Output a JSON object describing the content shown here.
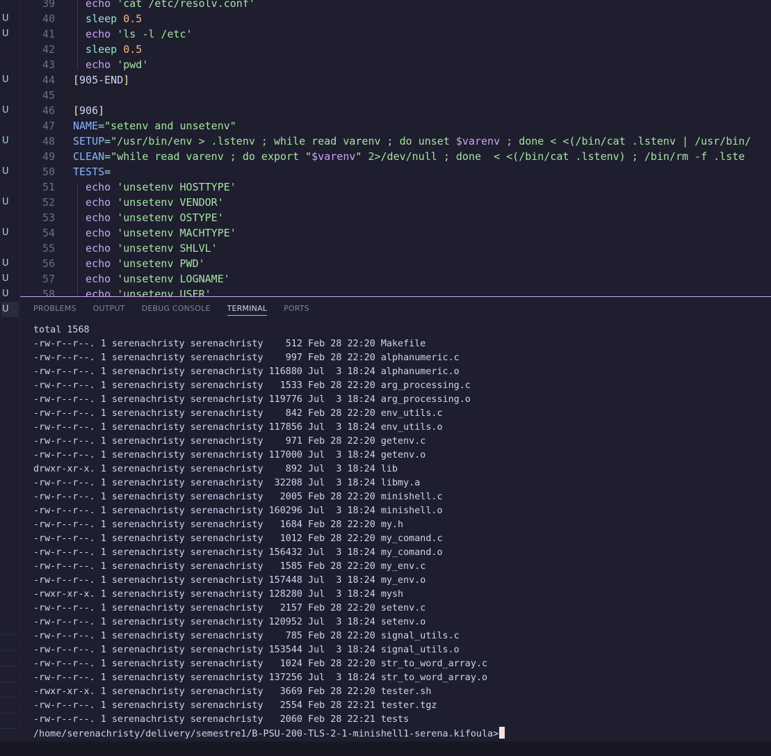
{
  "gutter": {
    "marks": [
      {
        "line": 40,
        "label": "U"
      },
      {
        "line": 41,
        "label": "U"
      },
      {
        "line": 44,
        "label": "U"
      },
      {
        "line": 46,
        "label": "U"
      },
      {
        "line": 48,
        "label": "U"
      },
      {
        "line": 50,
        "label": "U"
      },
      {
        "line": 52,
        "label": "U"
      },
      {
        "line": 54,
        "label": "U"
      },
      {
        "line": 56,
        "label": "U"
      },
      {
        "line": 57,
        "label": "U"
      },
      {
        "line": 58,
        "label": "U"
      },
      {
        "line": 59,
        "label": "U"
      }
    ]
  },
  "editor": {
    "lines": [
      {
        "n": "39",
        "tokens": [
          [
            "kw",
            "  echo "
          ],
          [
            "str",
            "'cat /etc/resolv.conf'"
          ]
        ]
      },
      {
        "n": "40",
        "tokens": [
          [
            "op",
            "  sleep "
          ],
          [
            "num",
            "0.5"
          ]
        ]
      },
      {
        "n": "41",
        "tokens": [
          [
            "kw",
            "  echo "
          ],
          [
            "str",
            "'ls -l /etc'"
          ]
        ]
      },
      {
        "n": "42",
        "tokens": [
          [
            "op",
            "  sleep "
          ],
          [
            "num",
            "0.5"
          ]
        ]
      },
      {
        "n": "43",
        "tokens": [
          [
            "kw",
            "  echo "
          ],
          [
            "str",
            "'pwd'"
          ]
        ]
      },
      {
        "n": "44",
        "tokens": [
          [
            "bracket",
            "["
          ],
          [
            "sect",
            "905-END"
          ],
          [
            "bracket",
            "]"
          ]
        ]
      },
      {
        "n": "45",
        "tokens": []
      },
      {
        "n": "46",
        "tokens": [
          [
            "bracket",
            "["
          ],
          [
            "sect",
            "906"
          ],
          [
            "bracket",
            "]"
          ]
        ]
      },
      {
        "n": "47",
        "tokens": [
          [
            "var",
            "NAME"
          ],
          [
            "op",
            "="
          ],
          [
            "str",
            "\"setenv and unsetenv\""
          ]
        ]
      },
      {
        "n": "48",
        "tokens": [
          [
            "var",
            "SETUP"
          ],
          [
            "op",
            "="
          ],
          [
            "str",
            "\"/usr/bin/env > .lstenv ; while read varenv ; do unset "
          ],
          [
            "dol",
            "$varenv"
          ],
          [
            "str",
            " ; done < <(/bin/cat .lstenv | /usr/bin/"
          ]
        ]
      },
      {
        "n": "49",
        "tokens": [
          [
            "var",
            "CLEAN"
          ],
          [
            "op",
            "="
          ],
          [
            "str",
            "\"while read varenv ; do export \""
          ],
          [
            "dol",
            "$varenv"
          ],
          [
            "str",
            "\" 2>/dev/null ; done  < <(/bin/cat .lstenv) ; /bin/rm -f .lste"
          ]
        ]
      },
      {
        "n": "50",
        "tokens": [
          [
            "var",
            "TESTS"
          ],
          [
            "op",
            "="
          ]
        ]
      },
      {
        "n": "51",
        "tokens": [
          [
            "kw",
            "  echo "
          ],
          [
            "str",
            "'unsetenv HOSTTYPE'"
          ]
        ]
      },
      {
        "n": "52",
        "tokens": [
          [
            "kw",
            "  echo "
          ],
          [
            "str",
            "'unsetenv VENDOR'"
          ]
        ]
      },
      {
        "n": "53",
        "tokens": [
          [
            "kw",
            "  echo "
          ],
          [
            "str",
            "'unsetenv OSTYPE'"
          ]
        ]
      },
      {
        "n": "54",
        "tokens": [
          [
            "kw",
            "  echo "
          ],
          [
            "str",
            "'unsetenv MACHTYPE'"
          ]
        ]
      },
      {
        "n": "55",
        "tokens": [
          [
            "kw",
            "  echo "
          ],
          [
            "str",
            "'unsetenv SHLVL'"
          ]
        ]
      },
      {
        "n": "56",
        "tokens": [
          [
            "kw",
            "  echo "
          ],
          [
            "str",
            "'unsetenv PWD'"
          ]
        ]
      },
      {
        "n": "57",
        "tokens": [
          [
            "kw",
            "  echo "
          ],
          [
            "str",
            "'unsetenv LOGNAME'"
          ]
        ]
      },
      {
        "n": "58",
        "tokens": [
          [
            "kw",
            "  echo "
          ],
          [
            "str",
            "'unsetenv USER'"
          ]
        ]
      }
    ]
  },
  "panel": {
    "tabs": [
      {
        "label": "PROBLEMS",
        "active": false
      },
      {
        "label": "OUTPUT",
        "active": false
      },
      {
        "label": "DEBUG CONSOLE",
        "active": false
      },
      {
        "label": "TERMINAL",
        "active": true
      },
      {
        "label": "PORTS",
        "active": false
      }
    ]
  },
  "terminal": {
    "lines": [
      "total 1568",
      "-rw-r--r--. 1 serenachristy serenachristy    512 Feb 28 22:20 Makefile",
      "-rw-r--r--. 1 serenachristy serenachristy    997 Feb 28 22:20 alphanumeric.c",
      "-rw-r--r--. 1 serenachristy serenachristy 116880 Jul  3 18:24 alphanumeric.o",
      "-rw-r--r--. 1 serenachristy serenachristy   1533 Feb 28 22:20 arg_processing.c",
      "-rw-r--r--. 1 serenachristy serenachristy 119776 Jul  3 18:24 arg_processing.o",
      "-rw-r--r--. 1 serenachristy serenachristy    842 Feb 28 22:20 env_utils.c",
      "-rw-r--r--. 1 serenachristy serenachristy 117856 Jul  3 18:24 env_utils.o",
      "-rw-r--r--. 1 serenachristy serenachristy    971 Feb 28 22:20 getenv.c",
      "-rw-r--r--. 1 serenachristy serenachristy 117000 Jul  3 18:24 getenv.o",
      "drwxr-xr-x. 1 serenachristy serenachristy    892 Jul  3 18:24 lib",
      "-rw-r--r--. 1 serenachristy serenachristy  32208 Jul  3 18:24 libmy.a",
      "-rw-r--r--. 1 serenachristy serenachristy   2005 Feb 28 22:20 minishell.c",
      "-rw-r--r--. 1 serenachristy serenachristy 160296 Jul  3 18:24 minishell.o",
      "-rw-r--r--. 1 serenachristy serenachristy   1684 Feb 28 22:20 my.h",
      "-rw-r--r--. 1 serenachristy serenachristy   1012 Feb 28 22:20 my_comand.c",
      "-rw-r--r--. 1 serenachristy serenachristy 156432 Jul  3 18:24 my_comand.o",
      "-rw-r--r--. 1 serenachristy serenachristy   1585 Feb 28 22:20 my_env.c",
      "-rw-r--r--. 1 serenachristy serenachristy 157448 Jul  3 18:24 my_env.o",
      "-rwxr-xr-x. 1 serenachristy serenachristy 128280 Jul  3 18:24 mysh",
      "-rw-r--r--. 1 serenachristy serenachristy   2157 Feb 28 22:20 setenv.c",
      "-rw-r--r--. 1 serenachristy serenachristy 120952 Jul  3 18:24 setenv.o",
      "-rw-r--r--. 1 serenachristy serenachristy    785 Feb 28 22:20 signal_utils.c",
      "-rw-r--r--. 1 serenachristy serenachristy 153544 Jul  3 18:24 signal_utils.o",
      "-rw-r--r--. 1 serenachristy serenachristy   1024 Feb 28 22:20 str_to_word_array.c",
      "-rw-r--r--. 1 serenachristy serenachristy 137256 Jul  3 18:24 str_to_word_array.o",
      "-rwxr-xr-x. 1 serenachristy serenachristy   3669 Feb 28 22:20 tester.sh",
      "-rw-r--r--. 1 serenachristy serenachristy   2554 Feb 28 22:21 tester.tgz",
      "-rw-r--r--. 1 serenachristy serenachristy   2060 Feb 28 22:21 tests"
    ],
    "prompt": "/home/serenachristy/delivery/semestre1/B-PSU-200-TLS-2-1-minishell1-serena.kifoula>"
  }
}
